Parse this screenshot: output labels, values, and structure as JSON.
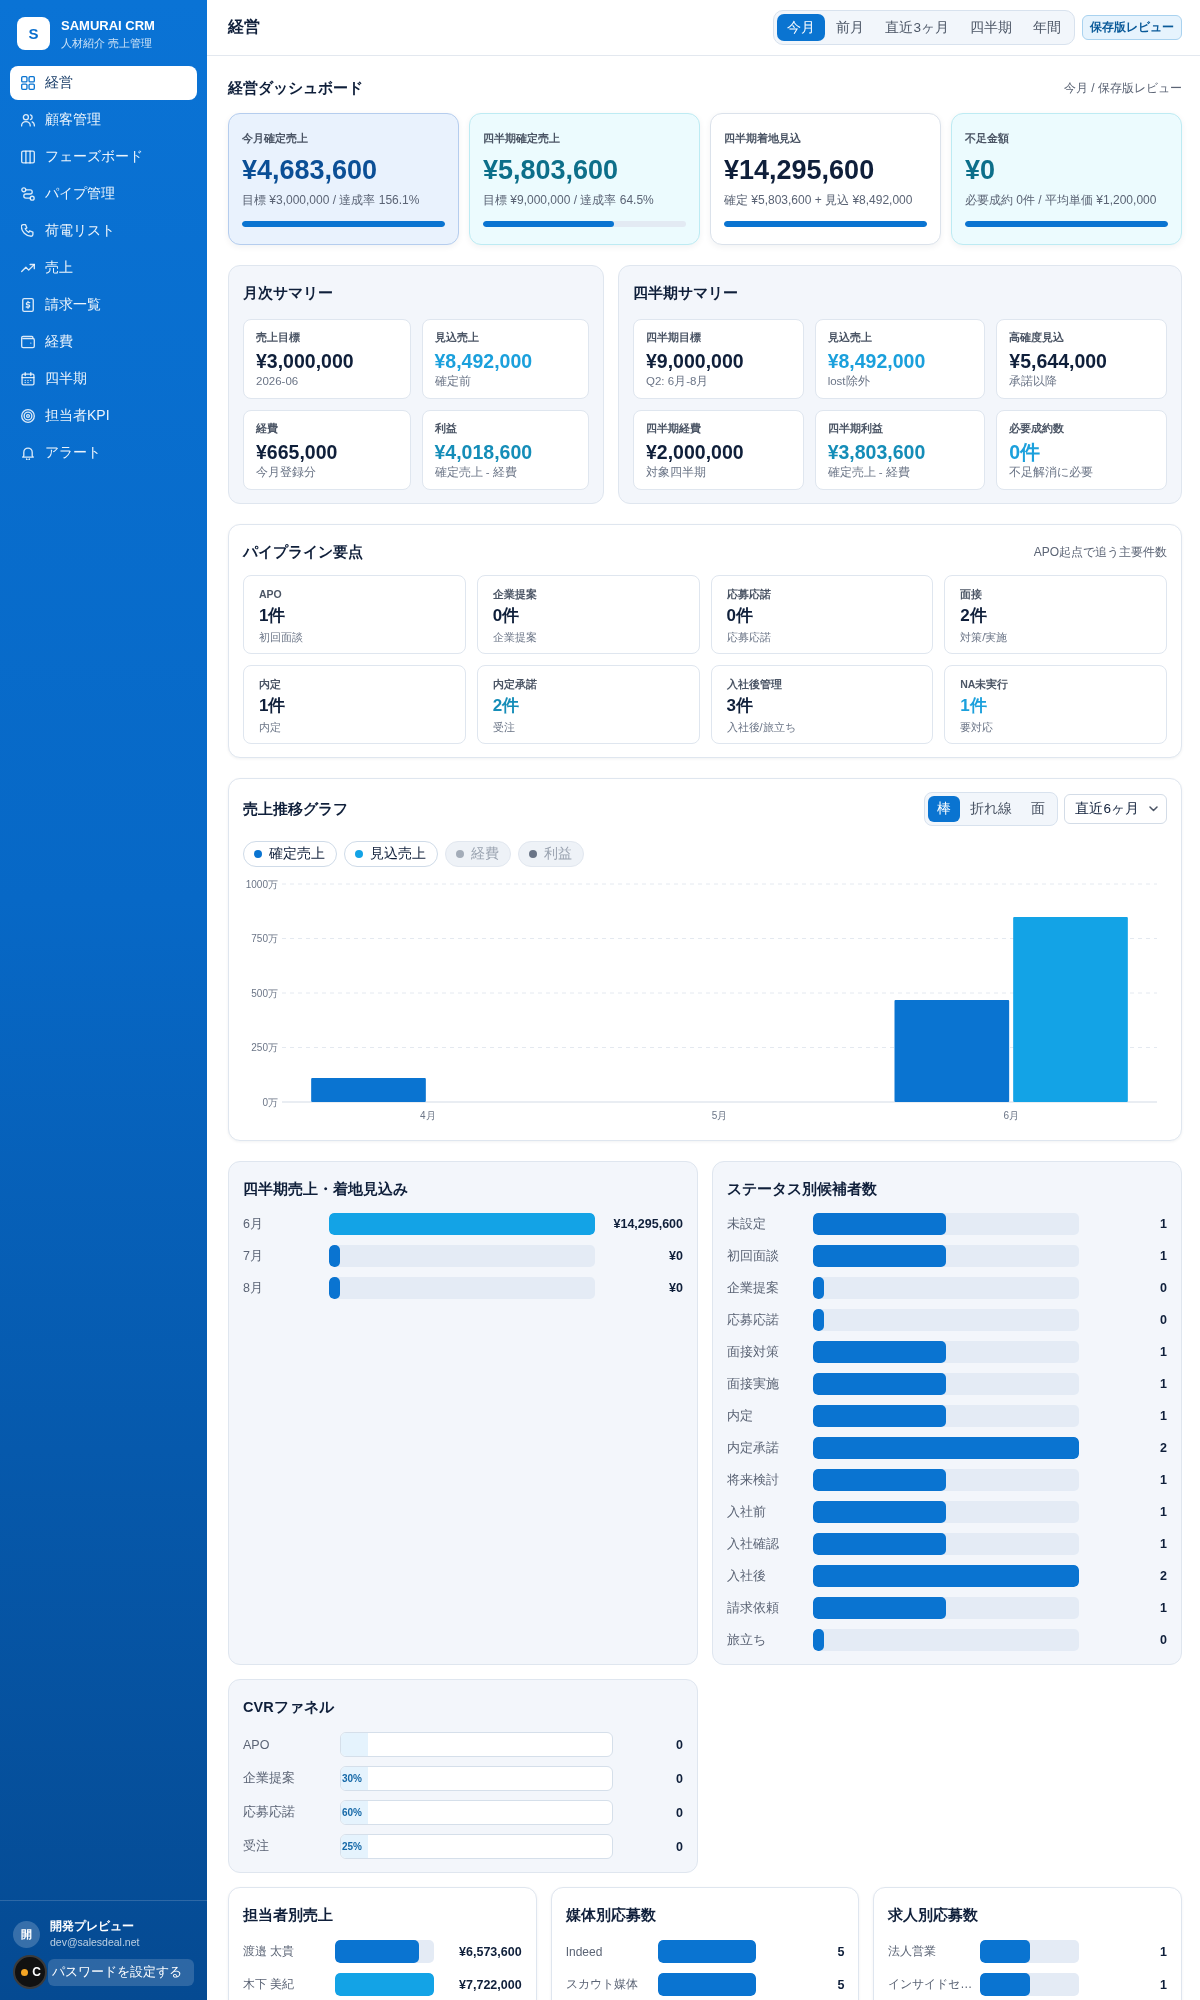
{
  "sidebar": {
    "brand": {
      "logo": "S",
      "name": "SAMURAI CRM",
      "subtitle": "人材紹介 売上管理"
    },
    "items": [
      {
        "label": "経営",
        "selected": true
      },
      {
        "label": "顧客管理",
        "selected": false
      },
      {
        "label": "フェーズボード",
        "selected": false
      },
      {
        "label": "パイプ管理",
        "selected": false
      },
      {
        "label": "荷電リスト",
        "selected": false
      },
      {
        "label": "売上",
        "selected": false
      },
      {
        "label": "請求一覧",
        "selected": false
      },
      {
        "label": "経費",
        "selected": false
      },
      {
        "label": "四半期",
        "selected": false
      },
      {
        "label": "担当者KPI",
        "selected": false
      },
      {
        "label": "アラート",
        "selected": false
      }
    ],
    "user": {
      "avatar": "開",
      "name": "開発プレビュー",
      "email": "dev@salesdeal.net"
    },
    "password_button": "パスワードを設定する",
    "overlay_badge": "C"
  },
  "header": {
    "title": "経営",
    "periods": [
      {
        "label": "今月",
        "selected": true
      },
      {
        "label": "前月",
        "selected": false
      },
      {
        "label": "直近3ヶ月",
        "selected": false
      },
      {
        "label": "四半期",
        "selected": false
      },
      {
        "label": "年間",
        "selected": false
      }
    ],
    "review_button": "保存版レビュー"
  },
  "dashboard": {
    "title": "経営ダッシュボード",
    "context": "今月 / 保存版レビュー",
    "kpis": [
      {
        "label": "今月確定売上",
        "value": "¥4,683,600",
        "note": "目標 ¥3,000,000 / 達成率 156.1%",
        "level": 1,
        "kind": "primary"
      },
      {
        "label": "四半期確定売上",
        "value": "¥5,803,600",
        "note": "目標 ¥9,000,000 / 達成率 64.5%",
        "level": 0.645,
        "kind": "accent"
      },
      {
        "label": "四半期着地見込",
        "value": "¥14,295,600",
        "note": "確定 ¥5,803,600 + 見込 ¥8,492,000",
        "level": 1,
        "kind": "plain"
      },
      {
        "label": "不足金額",
        "value": "¥0",
        "note": "必要成約 0件 / 平均単価 ¥1,200,000",
        "level": 1,
        "kind": "accent"
      }
    ]
  },
  "monthly_summary": {
    "title": "月次サマリー",
    "cards": [
      {
        "label": "売上目標",
        "value": "¥3,000,000",
        "note": "2026-06",
        "kind": "plain"
      },
      {
        "label": "見込売上",
        "value": "¥8,492,000",
        "note": "確定前",
        "kind": "sky"
      },
      {
        "label": "経費",
        "value": "¥665,000",
        "note": "今月登録分",
        "kind": "plain"
      },
      {
        "label": "利益",
        "value": "¥4,018,600",
        "note": "確定売上 - 経費",
        "kind": "teal"
      }
    ]
  },
  "quarterly_summary": {
    "title": "四半期サマリー",
    "cards": [
      {
        "label": "四半期目標",
        "value": "¥9,000,000",
        "note": "Q2: 6月-8月",
        "kind": "plain"
      },
      {
        "label": "見込売上",
        "value": "¥8,492,000",
        "note": "lost除外",
        "kind": "sky"
      },
      {
        "label": "高確度見込",
        "value": "¥5,644,000",
        "note": "承諾以降",
        "kind": "plain"
      },
      {
        "label": "四半期経費",
        "value": "¥2,000,000",
        "note": "対象四半期",
        "kind": "plain"
      },
      {
        "label": "四半期利益",
        "value": "¥3,803,600",
        "note": "確定売上 - 経費",
        "kind": "teal"
      },
      {
        "label": "必要成約数",
        "value": "0件",
        "note": "不足解消に必要",
        "kind": "sky"
      }
    ]
  },
  "pipeline": {
    "title": "パイプライン要点",
    "note": "APO起点で追う主要件数",
    "cards": [
      {
        "label": "APO",
        "value": "1件",
        "note": "初回面談",
        "kind": "plain"
      },
      {
        "label": "企業提案",
        "value": "0件",
        "note": "企業提案",
        "kind": "plain"
      },
      {
        "label": "応募応諾",
        "value": "0件",
        "note": "応募応諾",
        "kind": "plain"
      },
      {
        "label": "面接",
        "value": "2件",
        "note": "対策/実施",
        "kind": "plain"
      },
      {
        "label": "内定",
        "value": "1件",
        "note": "内定",
        "kind": "plain"
      },
      {
        "label": "内定承諾",
        "value": "2件",
        "note": "受注",
        "kind": "teal"
      },
      {
        "label": "入社後管理",
        "value": "3件",
        "note": "入社後/旅立ち",
        "kind": "plain"
      },
      {
        "label": "NA未実行",
        "value": "1件",
        "note": "要対応",
        "kind": "sky"
      }
    ]
  },
  "sales_chart": {
    "title": "売上推移グラフ",
    "views": [
      {
        "label": "棒",
        "selected": true
      },
      {
        "label": "折れ線",
        "selected": false
      },
      {
        "label": "面",
        "selected": false
      }
    ],
    "range": "直近6ヶ月",
    "series_toggles": [
      {
        "on": true
      },
      {
        "on": true
      },
      {
        "on": false
      },
      {
        "on": false
      }
    ],
    "chart_data": {
      "type": "bar",
      "categories": [
        "4月",
        "5月",
        "6月"
      ],
      "series": [
        {
          "name": "確定売上",
          "color": "#0a74d1",
          "values": [
            110,
            0,
            468
          ]
        },
        {
          "name": "見込売上",
          "color": "#13a3e6",
          "values": [
            0,
            0,
            849
          ]
        },
        {
          "name": "経費",
          "color": "#a3acb8",
          "values": [
            null,
            null,
            null
          ]
        },
        {
          "name": "利益",
          "color": "#6b7587",
          "values": [
            null,
            null,
            null
          ]
        }
      ],
      "ylim": [
        0,
        1000
      ],
      "yticks": [
        {
          "value": 0,
          "label": "0万"
        },
        {
          "value": 250,
          "label": "250万"
        },
        {
          "value": 500,
          "label": "500万"
        },
        {
          "value": 750,
          "label": "750万"
        },
        {
          "value": 1000,
          "label": "1000万"
        }
      ],
      "grid": true,
      "legend": "top-left"
    }
  },
  "quarterly_forecast": {
    "title": "四半期売上・着地見込み",
    "rows": [
      {
        "label": "6月",
        "level": 1,
        "color": "#13a3e6",
        "value": "¥14,295,600"
      },
      {
        "label": "7月",
        "level": 0.04,
        "color": "#0a74d1",
        "value": "¥0"
      },
      {
        "label": "8月",
        "level": 0.04,
        "color": "#0a74d1",
        "value": "¥0"
      }
    ]
  },
  "status_counts": {
    "title": "ステータス別候補者数",
    "rows": [
      {
        "label": "未設定",
        "level": 0.5,
        "value": "1"
      },
      {
        "label": "初回面談",
        "level": 0.5,
        "value": "1"
      },
      {
        "label": "企業提案",
        "level": 0.04,
        "value": "0"
      },
      {
        "label": "応募応諾",
        "level": 0.04,
        "value": "0"
      },
      {
        "label": "面接対策",
        "level": 0.5,
        "value": "1"
      },
      {
        "label": "面接実施",
        "level": 0.5,
        "value": "1"
      },
      {
        "label": "内定",
        "level": 0.5,
        "value": "1"
      },
      {
        "label": "内定承諾",
        "level": 1,
        "value": "2"
      },
      {
        "label": "将来検討",
        "level": 0.5,
        "value": "1"
      },
      {
        "label": "入社前",
        "level": 0.5,
        "value": "1"
      },
      {
        "label": "入社確認",
        "level": 0.5,
        "value": "1"
      },
      {
        "label": "入社後",
        "level": 1,
        "value": "2"
      },
      {
        "label": "請求依頼",
        "level": 0.5,
        "value": "1"
      },
      {
        "label": "旅立ち",
        "level": 0.04,
        "value": "0"
      }
    ]
  },
  "cvr_funnel": {
    "title": "CVRファネル",
    "rows": [
      {
        "label": "APO",
        "level": 0.1,
        "value": "0"
      },
      {
        "label": "企業提案",
        "rate": "30%",
        "level": 0.1,
        "value": "0"
      },
      {
        "label": "応募応諾",
        "rate": "60%",
        "level": 0.1,
        "value": "0"
      },
      {
        "label": "受注",
        "rate": "25%",
        "level": 0.1,
        "value": "0"
      }
    ]
  },
  "owner_sales": {
    "title": "担当者別売上",
    "rows": [
      {
        "label": "渡邉 太貴",
        "level": 0.85,
        "color": "#0a74d1",
        "value": "¥6,573,600"
      },
      {
        "label": "木下 美紀",
        "level": 1,
        "color": "#13a3e6",
        "value": "¥7,722,000"
      }
    ]
  },
  "media_applications": {
    "title": "媒体別応募数",
    "rows": [
      {
        "label": "Indeed",
        "level": 1,
        "value": "5"
      },
      {
        "label": "スカウト媒体",
        "level": 1,
        "value": "5"
      }
    ]
  },
  "job_applications": {
    "title": "求人別応募数",
    "rows": [
      {
        "label": "法人営業",
        "level": 0.5,
        "value": "1"
      },
      {
        "label": "インサイドセ…",
        "level": 0.5,
        "value": "1"
      }
    ]
  }
}
